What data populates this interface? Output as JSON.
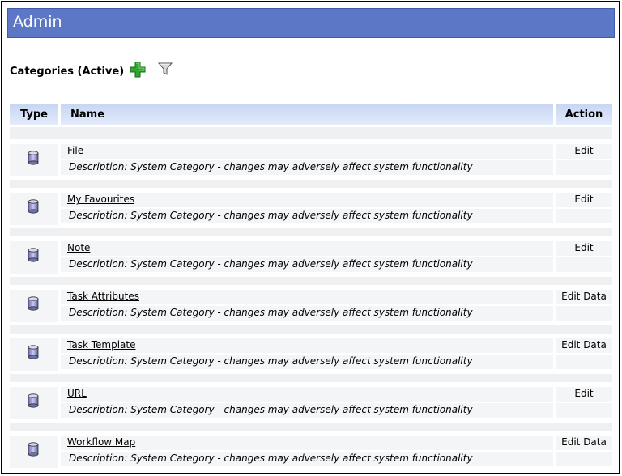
{
  "page": {
    "header_title": "Admin",
    "section_title": "Categories (Active)",
    "icons": {
      "add": "add-icon",
      "filter": "filter-icon",
      "category_type": "database-icon"
    }
  },
  "table": {
    "columns": [
      "Type",
      "Name",
      "Action"
    ],
    "rows": [
      {
        "name": "File",
        "description": "Description: System Category - changes may adversely affect system functionality",
        "action": "Edit"
      },
      {
        "name": "My Favourites",
        "description": "Description: System Category - changes may adversely affect system functionality",
        "action": "Edit"
      },
      {
        "name": "Note",
        "description": "Description: System Category - changes may adversely affect system functionality",
        "action": "Edit"
      },
      {
        "name": "Task Attributes",
        "description": "Description: System Category - changes may adversely affect system functionality",
        "action": "Edit Data"
      },
      {
        "name": "Task Template",
        "description": "Description: System Category - changes may adversely affect system functionality",
        "action": "Edit Data"
      },
      {
        "name": "URL",
        "description": "Description: System Category - changes may adversely affect system functionality",
        "action": "Edit"
      },
      {
        "name": "Workflow Map",
        "description": "Description: System Category - changes may adversely affect system functionality",
        "action": "Edit Data"
      }
    ]
  },
  "colors": {
    "header_bg": "#5b77c6",
    "table_header_bg": "#c7d6f3",
    "row_bg": "#f4f5f7",
    "add_green": "#2fa62f"
  }
}
